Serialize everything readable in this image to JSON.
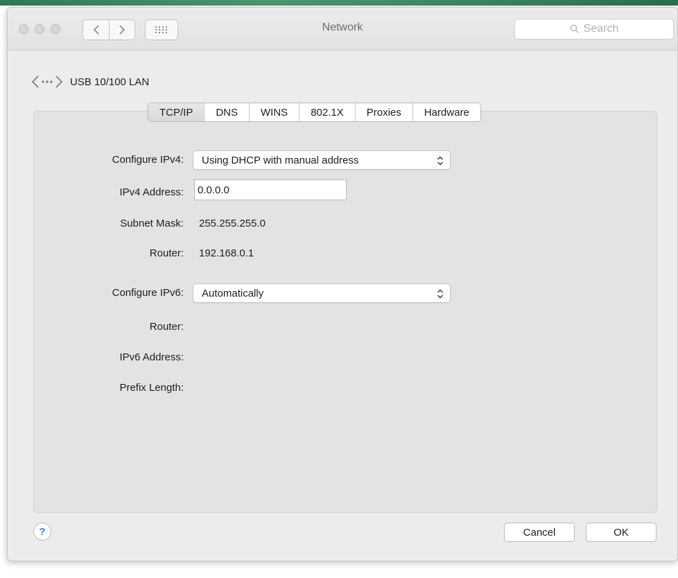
{
  "window": {
    "title": "Network"
  },
  "search": {
    "placeholder": "Search"
  },
  "connection": {
    "name": "USB 10/100 LAN"
  },
  "tabs": [
    {
      "label": "TCP/IP",
      "active": true
    },
    {
      "label": "DNS",
      "active": false
    },
    {
      "label": "WINS",
      "active": false
    },
    {
      "label": "802.1X",
      "active": false
    },
    {
      "label": "Proxies",
      "active": false
    },
    {
      "label": "Hardware",
      "active": false
    }
  ],
  "ipv4": {
    "configure_label": "Configure IPv4:",
    "configure_value": "Using DHCP with manual address",
    "address_label": "IPv4 Address:",
    "address_value": "0.0.0.0",
    "subnet_label": "Subnet Mask:",
    "subnet_value": "255.255.255.0",
    "router_label": "Router:",
    "router_value": "192.168.0.1"
  },
  "ipv6": {
    "configure_label": "Configure IPv6:",
    "configure_value": "Automatically",
    "router_label": "Router:",
    "address_label": "IPv6 Address:",
    "prefix_label": "Prefix Length:"
  },
  "footer": {
    "help_label": "?",
    "cancel_label": "Cancel",
    "ok_label": "OK"
  },
  "icons": {
    "back": "chevron-left-icon",
    "forward": "chevron-right-icon",
    "grid": "grid-icon",
    "search": "search-icon",
    "connection": "ethernet-icon",
    "popup": "updown-chevron-icon"
  },
  "colors": {
    "window_bg": "#ececec",
    "panel_bg": "#e3e3e3",
    "help_blue": "#3a7cf0",
    "desktop_green": "#3a8660"
  }
}
